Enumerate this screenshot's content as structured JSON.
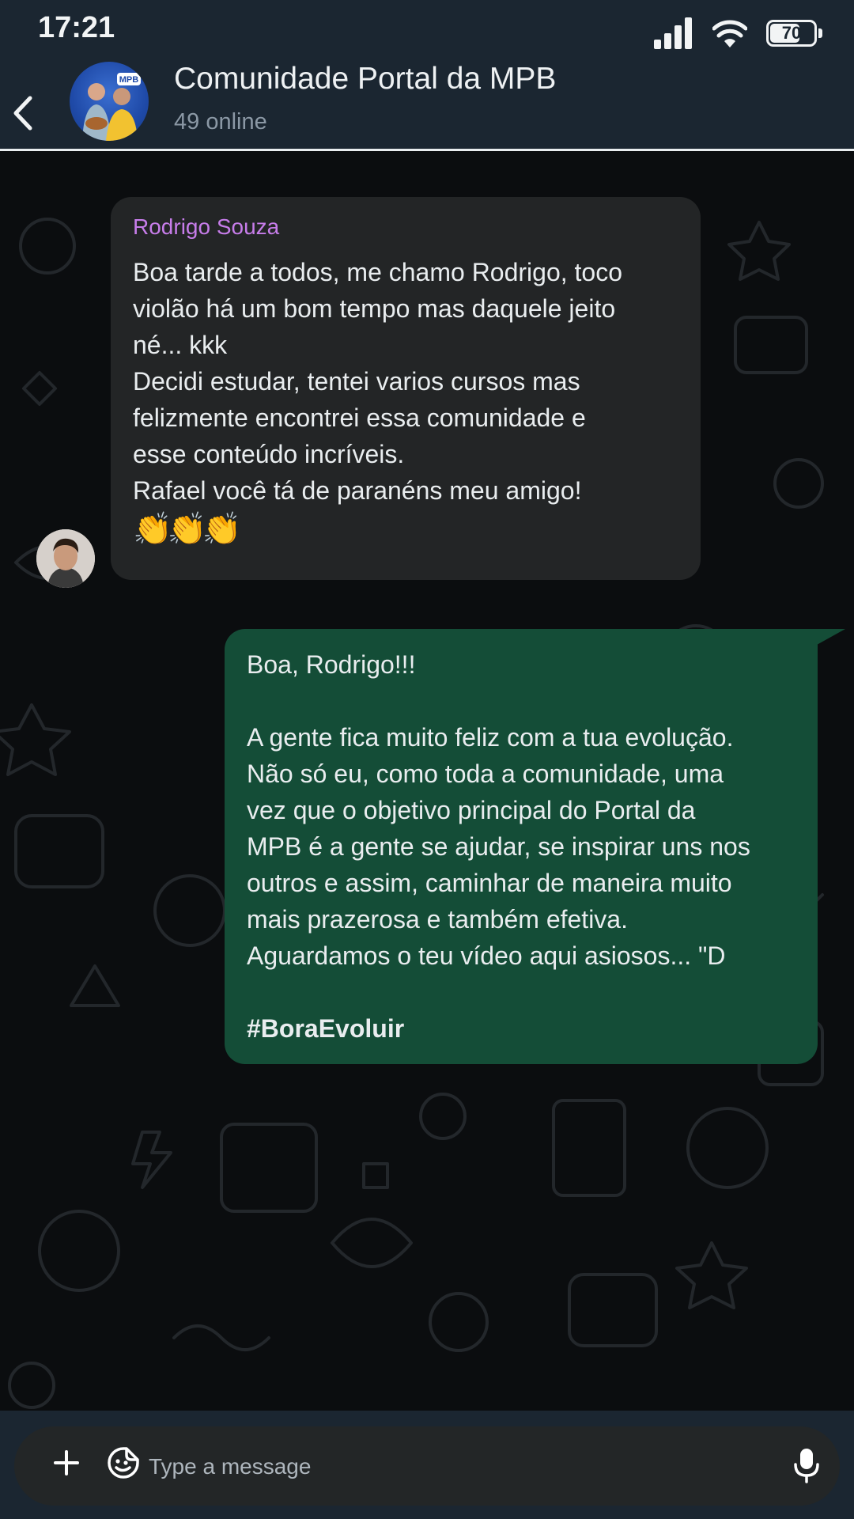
{
  "status_bar": {
    "time": "17:21",
    "battery": "70",
    "battery_level": 0.7,
    "icons": [
      "signal-icon",
      "wifi-icon",
      "battery-icon"
    ]
  },
  "header": {
    "back_icon": "chevron-left-icon",
    "title": "Comunidade Portal da MPB",
    "subtitle": "49 online",
    "avatar_badge": "MPB"
  },
  "messages": [
    {
      "direction": "incoming",
      "sender": "Rodrigo Souza",
      "text": "Boa tarde a todos, me chamo Rodrigo, toco\nviolão há um bom tempo mas daquele jeito\nné... kkk\nDecidi estudar, tentei varios cursos mas\nfelizmente encontrei essa comunidade e\nesse conteúdo incríveis.\nRafael você tá de paranéns meu amigo!",
      "emoji": "👏👏👏"
    },
    {
      "direction": "outgoing",
      "text": "Boa, Rodrigo!!!\n\nA gente fica muito feliz com a tua evolução.\nNão só eu, como toda a comunidade, uma\nvez que o objetivo principal do Portal da\nMPB é a gente se ajudar, se inspirar uns nos\noutros e assim, caminhar de maneira muito\nmais prazerosa e também efetiva.\nAguardamos o teu vídeo aqui asiosos... \"D",
      "hashtag": "#BoraEvoluir"
    }
  ],
  "composer": {
    "placeholder": "Type a message",
    "icons": [
      "plus-icon",
      "sticker-icon",
      "microphone-icon"
    ]
  },
  "colors": {
    "header_bg": "#1b2631",
    "incoming_bubble": "#232526",
    "outgoing_bubble": "#144d37",
    "sender_name": "#c77dea"
  }
}
